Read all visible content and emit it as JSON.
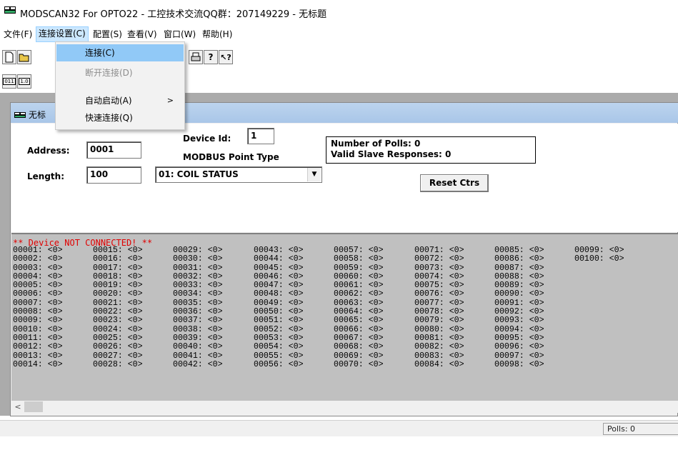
{
  "window": {
    "title": "MODSCAN32 For OPTO22 - 工控技术交流QQ群：207149229 - 无标题",
    "app_icon": "modscan-app-icon"
  },
  "menubar": [
    {
      "label": "文件(F)",
      "active": false
    },
    {
      "label": "连接设置(C)",
      "active": true
    },
    {
      "label": "配置(S)",
      "active": false
    },
    {
      "label": "查看(V)",
      "active": false
    },
    {
      "label": "窗口(W)",
      "active": false
    },
    {
      "label": "帮助(H)",
      "active": false
    }
  ],
  "dropdown": {
    "items": [
      {
        "label": "连接(C)",
        "highlighted": true,
        "disabled": false,
        "submenu": false
      },
      {
        "label": "断开连接(D)",
        "highlighted": false,
        "disabled": true,
        "submenu": false
      },
      {
        "label": "自动启动(A)",
        "highlighted": false,
        "disabled": false,
        "submenu": true,
        "submenu_glyph": ">"
      },
      {
        "label": "快速连接(Q)",
        "highlighted": false,
        "disabled": false,
        "submenu": false
      }
    ]
  },
  "toolbar1": {
    "icons": [
      "new-document-icon",
      "open-folder-icon",
      "print-icon",
      "help-icon",
      "context-help-icon"
    ]
  },
  "toolbar2": {
    "icons": [
      "display-binary-icon",
      "display-decimal-icon"
    ]
  },
  "child_window": {
    "title": "无标"
  },
  "form": {
    "address_label": "Address:",
    "address_value": "0001",
    "device_id_label": "Device Id:",
    "device_id_value": "1",
    "point_type_label": "MODBUS Point Type",
    "length_label": "Length:",
    "length_value": "100",
    "point_type_value": "01: COIL STATUS",
    "polls_text": "Number of Polls: 0",
    "responses_text": "Valid Slave Responses: 0",
    "reset_label": "Reset Ctrs"
  },
  "data_view": {
    "warning": "** Device NOT CONNECTED! **",
    "columns": [
      [
        "00001: <0>",
        "00002: <0>",
        "00003: <0>",
        "00004: <0>",
        "00005: <0>",
        "00006: <0>",
        "00007: <0>",
        "00008: <0>",
        "00009: <0>",
        "00010: <0>",
        "00011: <0>",
        "00012: <0>",
        "00013: <0>",
        "00014: <0>"
      ],
      [
        "00015: <0>",
        "00016: <0>",
        "00017: <0>",
        "00018: <0>",
        "00019: <0>",
        "00020: <0>",
        "00021: <0>",
        "00022: <0>",
        "00023: <0>",
        "00024: <0>",
        "00025: <0>",
        "00026: <0>",
        "00027: <0>",
        "00028: <0>"
      ],
      [
        "00029: <0>",
        "00030: <0>",
        "00031: <0>",
        "00032: <0>",
        "00033: <0>",
        "00034: <0>",
        "00035: <0>",
        "00036: <0>",
        "00037: <0>",
        "00038: <0>",
        "00039: <0>",
        "00040: <0>",
        "00041: <0>",
        "00042: <0>"
      ],
      [
        "00043: <0>",
        "00044: <0>",
        "00045: <0>",
        "00046: <0>",
        "00047: <0>",
        "00048: <0>",
        "00049: <0>",
        "00050: <0>",
        "00051: <0>",
        "00052: <0>",
        "00053: <0>",
        "00054: <0>",
        "00055: <0>",
        "00056: <0>"
      ],
      [
        "00057: <0>",
        "00058: <0>",
        "00059: <0>",
        "00060: <0>",
        "00061: <0>",
        "00062: <0>",
        "00063: <0>",
        "00064: <0>",
        "00065: <0>",
        "00066: <0>",
        "00067: <0>",
        "00068: <0>",
        "00069: <0>",
        "00070: <0>"
      ],
      [
        "00071: <0>",
        "00072: <0>",
        "00073: <0>",
        "00074: <0>",
        "00075: <0>",
        "00076: <0>",
        "00077: <0>",
        "00078: <0>",
        "00079: <0>",
        "00080: <0>",
        "00081: <0>",
        "00082: <0>",
        "00083: <0>",
        "00084: <0>"
      ],
      [
        "00085: <0>",
        "00086: <0>",
        "00087: <0>",
        "00088: <0>",
        "00089: <0>",
        "00090: <0>",
        "00091: <0>",
        "00092: <0>",
        "00093: <0>",
        "00094: <0>",
        "00095: <0>",
        "00096: <0>",
        "00097: <0>",
        "00098: <0>"
      ],
      [
        "00099: <0>",
        "00100: <0>"
      ]
    ],
    "scroll_left_glyph": "<"
  },
  "statusbar": {
    "polls": "Polls: 0"
  },
  "colors": {
    "menu_active": "#cce8ff",
    "dropdown_highlight": "#91c9f7",
    "warning_text": "#e00000",
    "data_bg": "#c0c0c0",
    "mdi_bg": "#ababab"
  }
}
